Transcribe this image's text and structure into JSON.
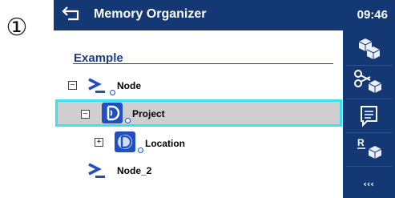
{
  "marker": "①",
  "header": {
    "title": "Memory Organizer",
    "time": "09:46"
  },
  "section_label": "Node",
  "tree": {
    "root": "Example",
    "items": [
      {
        "label": "Node",
        "toggle": "–",
        "icon": "node-icon"
      },
      {
        "label": "Project",
        "toggle": "–",
        "icon": "project-icon",
        "selected": true
      },
      {
        "label": "Location",
        "toggle": "+",
        "icon": "location-icon"
      },
      {
        "label": "Node_2",
        "toggle": "",
        "icon": "node-icon"
      }
    ]
  },
  "sidebar": {
    "buttons": [
      {
        "icon": "add-structure-icon"
      },
      {
        "icon": "cut-icon"
      },
      {
        "icon": "comment-icon"
      },
      {
        "icon": "rename-icon",
        "text": "R"
      },
      {
        "icon": "more-icon",
        "text": "‹‹‹"
      }
    ]
  },
  "colors": {
    "titlebar": "#143873",
    "selection_border": "#3fe0ee",
    "selection_fill": "#cfcfcf",
    "accent": "#1a3f8a"
  }
}
